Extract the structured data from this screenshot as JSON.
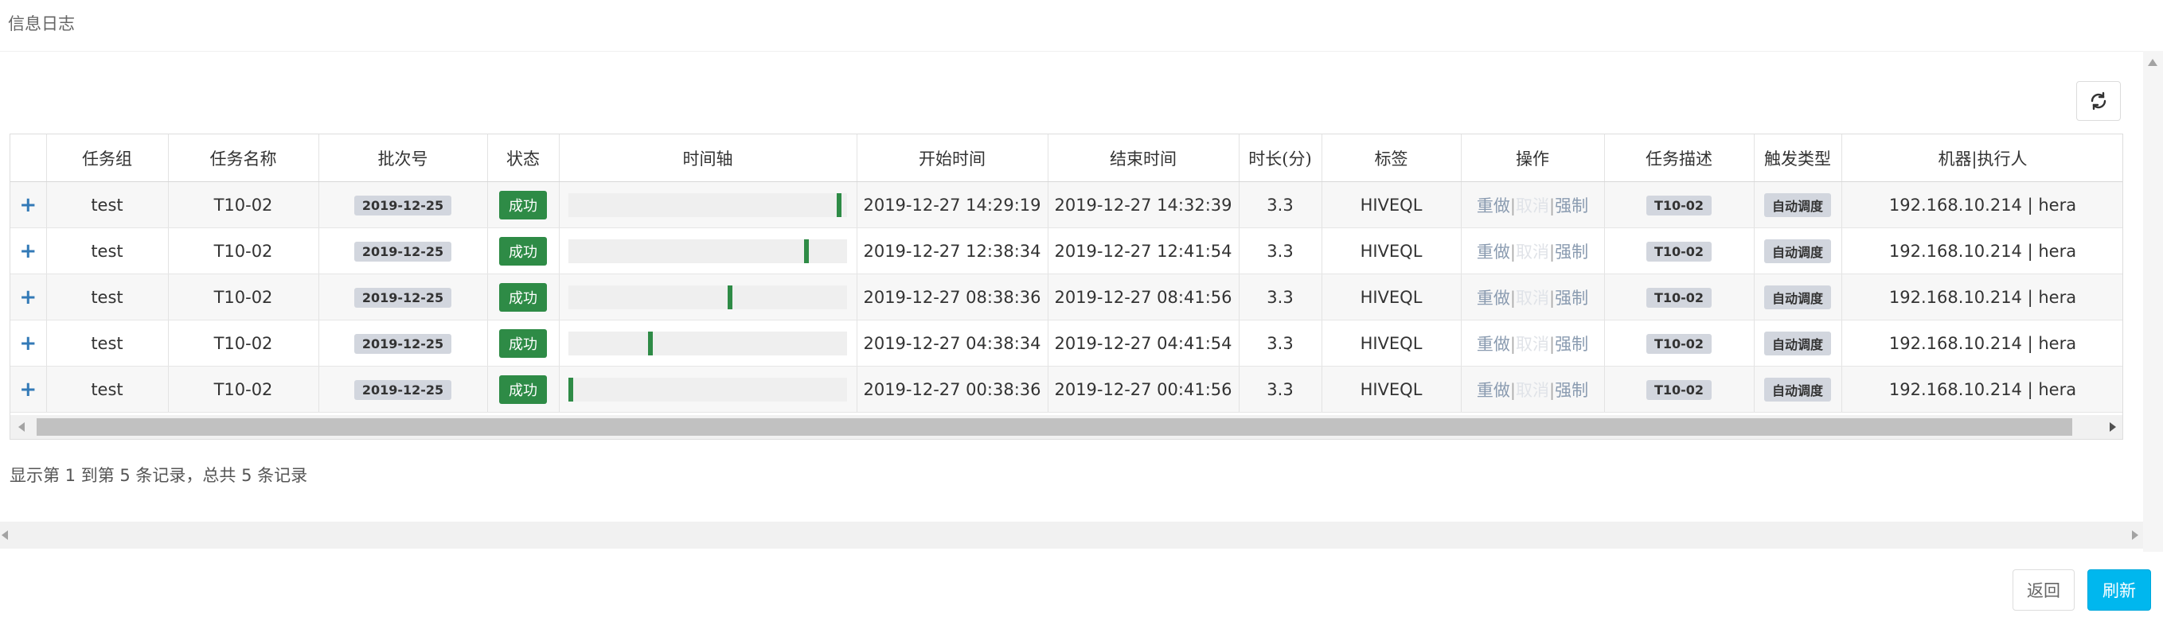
{
  "page": {
    "title": "信息日志"
  },
  "toolbar": {
    "refresh_icon": "refresh-icon"
  },
  "table": {
    "headers": [
      "",
      "任务组",
      "任务名称",
      "批次号",
      "状态",
      "时间轴",
      "开始时间",
      "结束时间",
      "时长(分)",
      "标签",
      "操作",
      "任务描述",
      "触发类型",
      "机器|执行人"
    ],
    "rows": [
      {
        "expand": "+",
        "group": "test",
        "name": "T10-02",
        "batch": "2019-12-25",
        "status": "成功",
        "timeline": 0.98,
        "start": "2019-12-27 14:29:19",
        "end": "2019-12-27 14:32:39",
        "duration": "3.3",
        "tag": "HIVEQL",
        "op_redo": "重做",
        "op_cancel": "取消",
        "op_force": "强制",
        "desc": "T10-02",
        "trigger": "自动调度",
        "machine": "192.168.10.214 | hera"
      },
      {
        "expand": "+",
        "group": "test",
        "name": "T10-02",
        "batch": "2019-12-25",
        "status": "成功",
        "timeline": 0.86,
        "start": "2019-12-27 12:38:34",
        "end": "2019-12-27 12:41:54",
        "duration": "3.3",
        "tag": "HIVEQL",
        "op_redo": "重做",
        "op_cancel": "取消",
        "op_force": "强制",
        "desc": "T10-02",
        "trigger": "自动调度",
        "machine": "192.168.10.214 | hera"
      },
      {
        "expand": "+",
        "group": "test",
        "name": "T10-02",
        "batch": "2019-12-25",
        "status": "成功",
        "timeline": 0.58,
        "start": "2019-12-27 08:38:36",
        "end": "2019-12-27 08:41:56",
        "duration": "3.3",
        "tag": "HIVEQL",
        "op_redo": "重做",
        "op_cancel": "取消",
        "op_force": "强制",
        "desc": "T10-02",
        "trigger": "自动调度",
        "machine": "192.168.10.214 | hera"
      },
      {
        "expand": "+",
        "group": "test",
        "name": "T10-02",
        "batch": "2019-12-25",
        "status": "成功",
        "timeline": 0.29,
        "start": "2019-12-27 04:38:34",
        "end": "2019-12-27 04:41:54",
        "duration": "3.3",
        "tag": "HIVEQL",
        "op_redo": "重做",
        "op_cancel": "取消",
        "op_force": "强制",
        "desc": "T10-02",
        "trigger": "自动调度",
        "machine": "192.168.10.214 | hera"
      },
      {
        "expand": "+",
        "group": "test",
        "name": "T10-02",
        "batch": "2019-12-25",
        "status": "成功",
        "timeline": 0.0,
        "start": "2019-12-27 00:38:36",
        "end": "2019-12-27 00:41:56",
        "duration": "3.3",
        "tag": "HIVEQL",
        "op_redo": "重做",
        "op_cancel": "取消",
        "op_force": "强制",
        "desc": "T10-02",
        "trigger": "自动调度",
        "machine": "192.168.10.214 | hera"
      }
    ]
  },
  "pagination": {
    "info": "显示第 1 到第 5 条记录，总共 5 条记录"
  },
  "footer": {
    "back_label": "返回",
    "refresh_label": "刷新"
  },
  "colors": {
    "success": "#2e8b46",
    "primary": "#00b7ee",
    "tag_gray": "#d2d6de"
  }
}
